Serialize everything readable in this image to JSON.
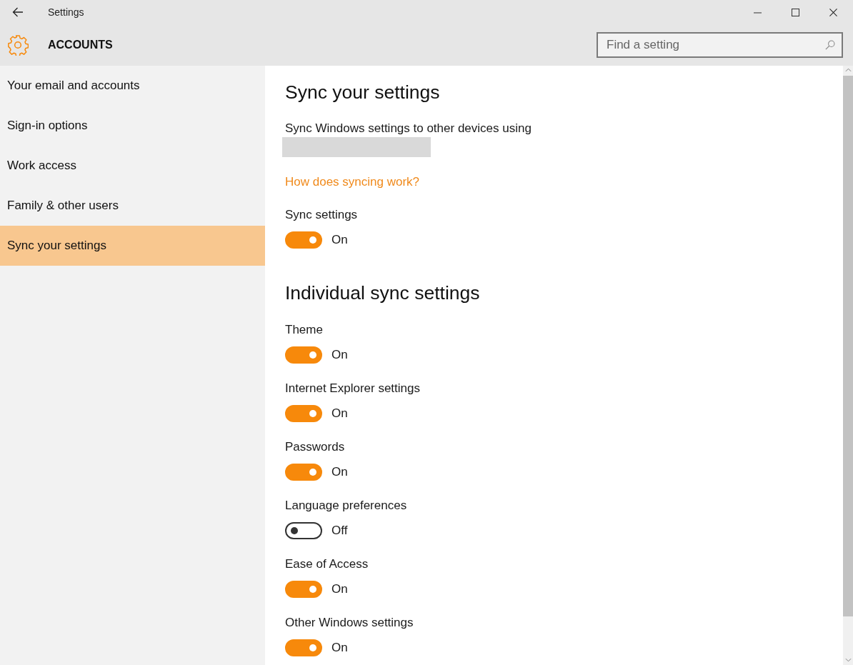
{
  "window": {
    "title": "Settings"
  },
  "header": {
    "section": "ACCOUNTS",
    "search": {
      "placeholder": "Find a setting"
    }
  },
  "sidebar": {
    "items": [
      {
        "label": "Your email and accounts",
        "selected": false
      },
      {
        "label": "Sign-in options",
        "selected": false
      },
      {
        "label": "Work access",
        "selected": false
      },
      {
        "label": "Family & other users",
        "selected": false
      },
      {
        "label": "Sync your settings",
        "selected": true
      }
    ]
  },
  "content": {
    "title": "Sync your settings",
    "description": "Sync Windows settings to other devices using",
    "link": "How does syncing work?",
    "sync": {
      "label": "Sync settings",
      "on": true,
      "state_label": "On"
    },
    "individual_title": "Individual sync settings",
    "settings": [
      {
        "label": "Theme",
        "on": true,
        "state_label": "On"
      },
      {
        "label": "Internet Explorer settings",
        "on": true,
        "state_label": "On"
      },
      {
        "label": "Passwords",
        "on": true,
        "state_label": "On"
      },
      {
        "label": "Language preferences",
        "on": false,
        "state_label": "Off"
      },
      {
        "label": "Ease of Access",
        "on": true,
        "state_label": "On"
      },
      {
        "label": "Other Windows settings",
        "on": true,
        "state_label": "On"
      }
    ]
  }
}
